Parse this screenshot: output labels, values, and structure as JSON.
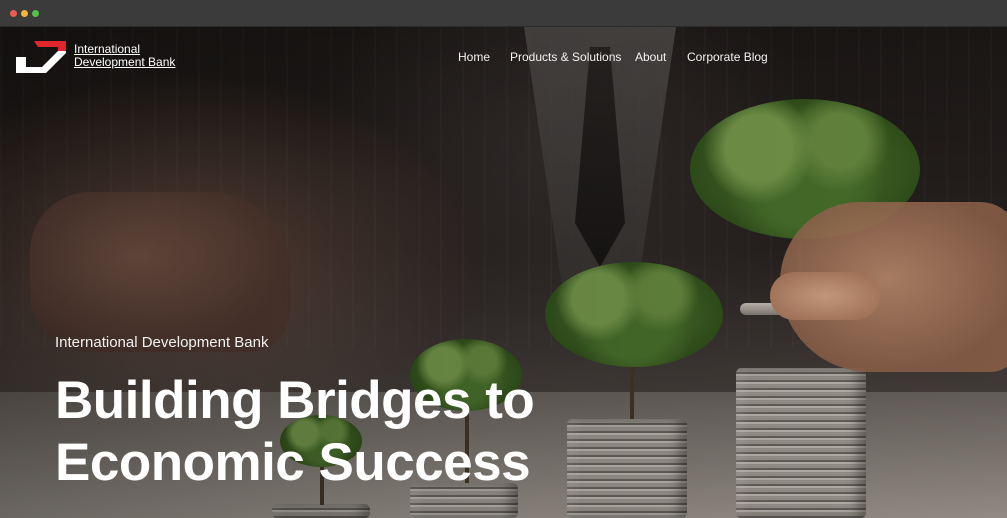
{
  "window": {
    "controls": [
      "close",
      "minimize",
      "maximize"
    ]
  },
  "brand": {
    "line1": "International",
    "line2": "Development Bank",
    "logo_icon": "idb-chevron-logo",
    "accent_color": "#e0262d"
  },
  "nav": {
    "items": [
      {
        "label": "Home"
      },
      {
        "label": "Products & Solutions"
      },
      {
        "label": "About"
      },
      {
        "label": "Corporate Blog"
      }
    ]
  },
  "hero": {
    "eyebrow": "International Development Bank",
    "headline_line1": "Building Bridges to",
    "headline_line2": "Economic Success",
    "image_subject": "hand placing coin on stacks of coins with growing trees"
  }
}
